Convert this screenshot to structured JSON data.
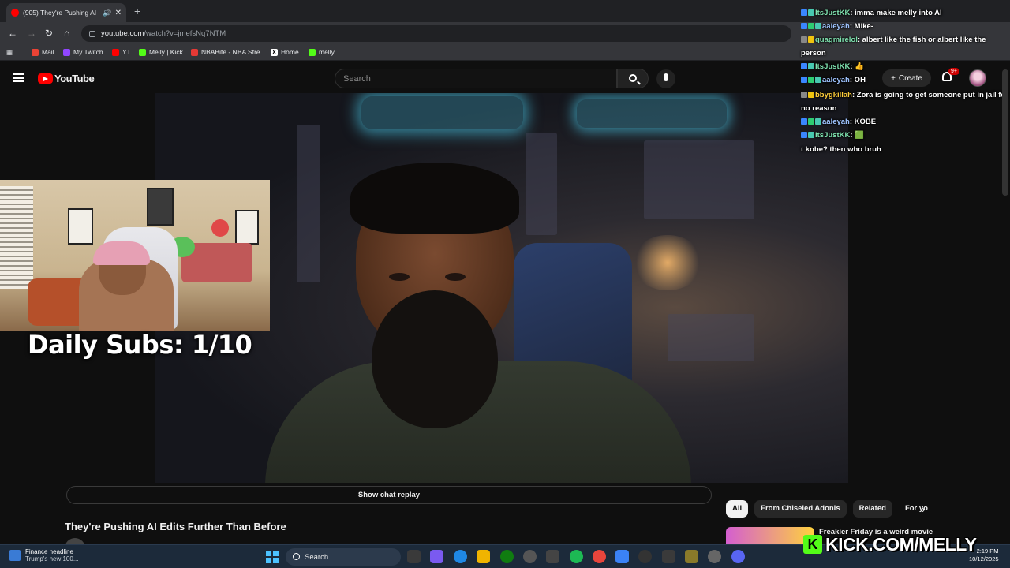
{
  "browser": {
    "tab_title": "(905) They're Pushing AI Ed",
    "url_host": "youtube.com",
    "url_path": "/watch?v=jmefsNq7NTM",
    "bookmarks": [
      {
        "label": "Mail",
        "color": "#ea4335"
      },
      {
        "label": "My Twitch",
        "color": "#9146ff"
      },
      {
        "label": "YT",
        "color": "#ff0000"
      },
      {
        "label": "Melly | Kick",
        "color": "#53fc18"
      },
      {
        "label": "NBABite - NBA Stre...",
        "color": "#e53935"
      },
      {
        "label": "Home",
        "color": "#ffffff"
      },
      {
        "label": "melly",
        "color": "#53fc18"
      }
    ]
  },
  "youtube": {
    "logo_text": "YouTube",
    "search_placeholder": "Search",
    "create_label": "Create",
    "notification_count": "9+",
    "show_chat_replay": "Show chat replay",
    "video_title": "They're Pushing AI Edits Further Than Before",
    "chips": [
      "All",
      "From Chiseled Adonis",
      "Related",
      "For yo"
    ],
    "recommended_title": "Freakier Friday is a weird movie"
  },
  "overlay": {
    "daily_subs": "Daily Subs: 1/10",
    "kick_url": "KICK.COM/MELLY"
  },
  "chat": [
    {
      "user": "ItsJustKK",
      "text": ": imma make melly into AI",
      "user_class": "u-kk",
      "badges": [
        "#3a86ff",
        "#48c9b0"
      ]
    },
    {
      "user": "aaleyah",
      "text": ": Mike-",
      "user_class": "u-aa",
      "badges": [
        "#3a86ff",
        "#2ecc71",
        "#48c9b0"
      ]
    },
    {
      "user": "quagmirelol",
      "text": ": albert like the fish or albert like the person",
      "user_class": "u-qq",
      "badges": [
        "#888888",
        "#f1c40f"
      ]
    },
    {
      "user": "ItsJustKK",
      "text": ": 👍",
      "user_class": "u-kk",
      "badges": [
        "#3a86ff",
        "#48c9b0"
      ]
    },
    {
      "user": "aaleyah",
      "text": ": OH",
      "user_class": "u-aa",
      "badges": [
        "#3a86ff",
        "#2ecc71",
        "#48c9b0"
      ]
    },
    {
      "user": "bbygkillah",
      "text": ": Zora is going to get someone put in jail for no reason",
      "user_class": "u-bb",
      "badges": [
        "#888888",
        "#f1c40f"
      ]
    },
    {
      "user": "aaleyah",
      "text": ": KOBE",
      "user_class": "u-aa",
      "badges": [
        "#3a86ff",
        "#2ecc71",
        "#48c9b0"
      ]
    },
    {
      "user": "ItsJustKK",
      "text": ": 🟩",
      "user_class": "u-kk",
      "badges": [
        "#3a86ff",
        "#48c9b0"
      ]
    },
    {
      "user": "",
      "text": "t kobe? then who bruh",
      "user_class": "u-kk",
      "badges": []
    }
  ],
  "taskbar": {
    "news_title": "Finance headline",
    "news_sub": "Trump's new 100...",
    "search_label": "Search",
    "time": "2:19 PM",
    "date": "10/12/2025"
  }
}
